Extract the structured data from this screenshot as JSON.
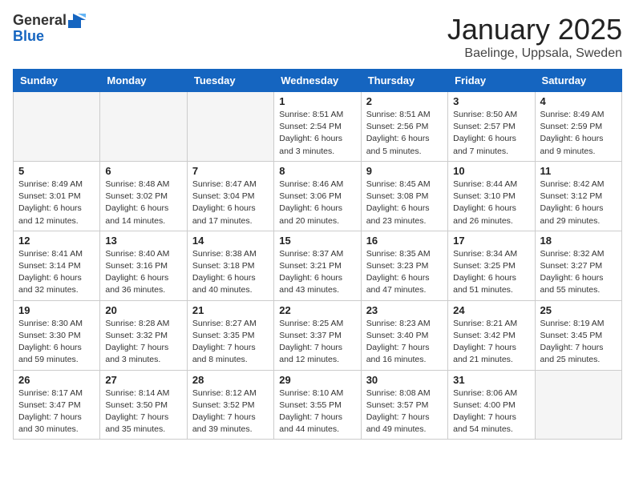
{
  "logo": {
    "line1": "General",
    "line2": "Blue"
  },
  "title": "January 2025",
  "subtitle": "Baelinge, Uppsala, Sweden",
  "weekdays": [
    "Sunday",
    "Monday",
    "Tuesday",
    "Wednesday",
    "Thursday",
    "Friday",
    "Saturday"
  ],
  "weeks": [
    [
      {
        "day": "",
        "info": ""
      },
      {
        "day": "",
        "info": ""
      },
      {
        "day": "",
        "info": ""
      },
      {
        "day": "1",
        "info": "Sunrise: 8:51 AM\nSunset: 2:54 PM\nDaylight: 6 hours and 3 minutes."
      },
      {
        "day": "2",
        "info": "Sunrise: 8:51 AM\nSunset: 2:56 PM\nDaylight: 6 hours and 5 minutes."
      },
      {
        "day": "3",
        "info": "Sunrise: 8:50 AM\nSunset: 2:57 PM\nDaylight: 6 hours and 7 minutes."
      },
      {
        "day": "4",
        "info": "Sunrise: 8:49 AM\nSunset: 2:59 PM\nDaylight: 6 hours and 9 minutes."
      }
    ],
    [
      {
        "day": "5",
        "info": "Sunrise: 8:49 AM\nSunset: 3:01 PM\nDaylight: 6 hours and 12 minutes."
      },
      {
        "day": "6",
        "info": "Sunrise: 8:48 AM\nSunset: 3:02 PM\nDaylight: 6 hours and 14 minutes."
      },
      {
        "day": "7",
        "info": "Sunrise: 8:47 AM\nSunset: 3:04 PM\nDaylight: 6 hours and 17 minutes."
      },
      {
        "day": "8",
        "info": "Sunrise: 8:46 AM\nSunset: 3:06 PM\nDaylight: 6 hours and 20 minutes."
      },
      {
        "day": "9",
        "info": "Sunrise: 8:45 AM\nSunset: 3:08 PM\nDaylight: 6 hours and 23 minutes."
      },
      {
        "day": "10",
        "info": "Sunrise: 8:44 AM\nSunset: 3:10 PM\nDaylight: 6 hours and 26 minutes."
      },
      {
        "day": "11",
        "info": "Sunrise: 8:42 AM\nSunset: 3:12 PM\nDaylight: 6 hours and 29 minutes."
      }
    ],
    [
      {
        "day": "12",
        "info": "Sunrise: 8:41 AM\nSunset: 3:14 PM\nDaylight: 6 hours and 32 minutes."
      },
      {
        "day": "13",
        "info": "Sunrise: 8:40 AM\nSunset: 3:16 PM\nDaylight: 6 hours and 36 minutes."
      },
      {
        "day": "14",
        "info": "Sunrise: 8:38 AM\nSunset: 3:18 PM\nDaylight: 6 hours and 40 minutes."
      },
      {
        "day": "15",
        "info": "Sunrise: 8:37 AM\nSunset: 3:21 PM\nDaylight: 6 hours and 43 minutes."
      },
      {
        "day": "16",
        "info": "Sunrise: 8:35 AM\nSunset: 3:23 PM\nDaylight: 6 hours and 47 minutes."
      },
      {
        "day": "17",
        "info": "Sunrise: 8:34 AM\nSunset: 3:25 PM\nDaylight: 6 hours and 51 minutes."
      },
      {
        "day": "18",
        "info": "Sunrise: 8:32 AM\nSunset: 3:27 PM\nDaylight: 6 hours and 55 minutes."
      }
    ],
    [
      {
        "day": "19",
        "info": "Sunrise: 8:30 AM\nSunset: 3:30 PM\nDaylight: 6 hours and 59 minutes."
      },
      {
        "day": "20",
        "info": "Sunrise: 8:28 AM\nSunset: 3:32 PM\nDaylight: 7 hours and 3 minutes."
      },
      {
        "day": "21",
        "info": "Sunrise: 8:27 AM\nSunset: 3:35 PM\nDaylight: 7 hours and 8 minutes."
      },
      {
        "day": "22",
        "info": "Sunrise: 8:25 AM\nSunset: 3:37 PM\nDaylight: 7 hours and 12 minutes."
      },
      {
        "day": "23",
        "info": "Sunrise: 8:23 AM\nSunset: 3:40 PM\nDaylight: 7 hours and 16 minutes."
      },
      {
        "day": "24",
        "info": "Sunrise: 8:21 AM\nSunset: 3:42 PM\nDaylight: 7 hours and 21 minutes."
      },
      {
        "day": "25",
        "info": "Sunrise: 8:19 AM\nSunset: 3:45 PM\nDaylight: 7 hours and 25 minutes."
      }
    ],
    [
      {
        "day": "26",
        "info": "Sunrise: 8:17 AM\nSunset: 3:47 PM\nDaylight: 7 hours and 30 minutes."
      },
      {
        "day": "27",
        "info": "Sunrise: 8:14 AM\nSunset: 3:50 PM\nDaylight: 7 hours and 35 minutes."
      },
      {
        "day": "28",
        "info": "Sunrise: 8:12 AM\nSunset: 3:52 PM\nDaylight: 7 hours and 39 minutes."
      },
      {
        "day": "29",
        "info": "Sunrise: 8:10 AM\nSunset: 3:55 PM\nDaylight: 7 hours and 44 minutes."
      },
      {
        "day": "30",
        "info": "Sunrise: 8:08 AM\nSunset: 3:57 PM\nDaylight: 7 hours and 49 minutes."
      },
      {
        "day": "31",
        "info": "Sunrise: 8:06 AM\nSunset: 4:00 PM\nDaylight: 7 hours and 54 minutes."
      },
      {
        "day": "",
        "info": ""
      }
    ]
  ]
}
